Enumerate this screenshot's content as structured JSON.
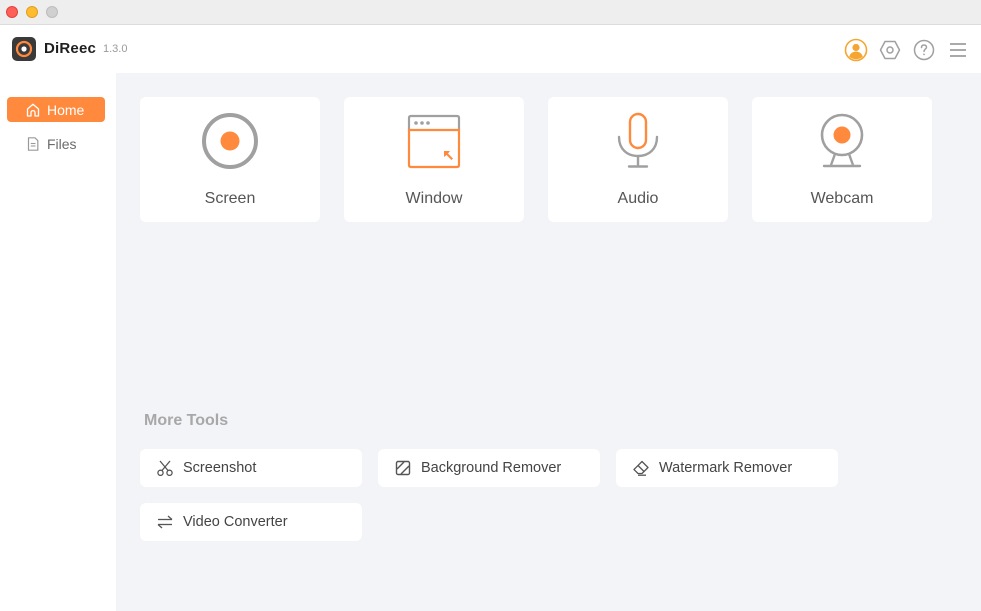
{
  "window": {
    "controls": [
      "close",
      "minimize",
      "maximize"
    ]
  },
  "header": {
    "app_name": "DiReec",
    "version": "1.3.0",
    "icons": [
      "account-icon",
      "settings-icon",
      "help-icon",
      "menu-icon"
    ]
  },
  "sidebar": {
    "items": [
      {
        "label": "Home",
        "icon": "home-icon",
        "active": true
      },
      {
        "label": "Files",
        "icon": "file-icon",
        "active": false
      }
    ]
  },
  "record_modes": [
    {
      "label": "Screen",
      "icon": "screen-record-icon"
    },
    {
      "label": "Window",
      "icon": "window-record-icon"
    },
    {
      "label": "Audio",
      "icon": "microphone-icon"
    },
    {
      "label": "Webcam",
      "icon": "webcam-icon"
    }
  ],
  "more_tools": {
    "title": "More Tools",
    "items": [
      {
        "label": "Screenshot",
        "icon": "scissors-icon"
      },
      {
        "label": "Background Remover",
        "icon": "background-remover-icon"
      },
      {
        "label": "Watermark Remover",
        "icon": "eraser-icon"
      },
      {
        "label": "Video Converter",
        "icon": "convert-arrows-icon"
      }
    ]
  },
  "colors": {
    "accent": "#ff8a3d",
    "icon_gray": "#a0a0a0",
    "main_bg": "#f3f4f8",
    "account_icon": "#f7a531"
  }
}
